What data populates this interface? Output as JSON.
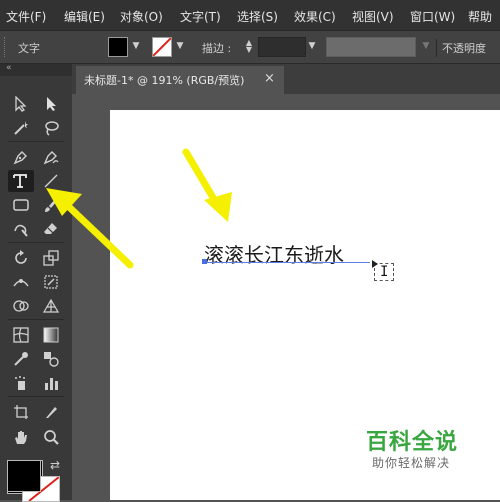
{
  "menu": [
    "文件(F)",
    "编辑(E)",
    "对象(O)",
    "文字(T)",
    "选择(S)",
    "效果(C)",
    "视图(V)",
    "窗口(W)",
    "帮助"
  ],
  "control_bar": {
    "tool_name": "文字",
    "stroke_label": "描边 :",
    "opacity_label": "不透明度",
    "fill_color": "#000000",
    "stroke_color": "#ffffff"
  },
  "document": {
    "tab_title": "未标题-1* @ 191% (RGB/预览)",
    "close_glyph": "×"
  },
  "canvas": {
    "text_content": "滚滚长江东逝水"
  },
  "tools": [
    "selection-tool",
    "direct-selection-tool",
    "magic-wand-tool",
    "lasso-tool",
    "pen-tool",
    "curvature-tool",
    "type-tool",
    "line-tool",
    "rectangle-tool",
    "paintbrush-tool",
    "shaper-tool",
    "eraser-tool",
    "rotate-tool",
    "scale-tool",
    "width-tool",
    "free-transform-tool",
    "shape-builder-tool",
    "perspective-grid-tool",
    "mesh-tool",
    "gradient-tool",
    "eyedropper-tool",
    "blend-tool",
    "symbol-sprayer-tool",
    "column-graph-tool",
    "artboard-tool",
    "slice-tool",
    "hand-tool",
    "zoom-tool"
  ],
  "colors": {
    "fill": "#000000",
    "stroke": "#ffffff",
    "arrow": "#f5f000",
    "accent_selection": "#4a6fe0"
  },
  "watermark": {
    "title": "百科全说",
    "subtitle": "助你轻松解决"
  }
}
